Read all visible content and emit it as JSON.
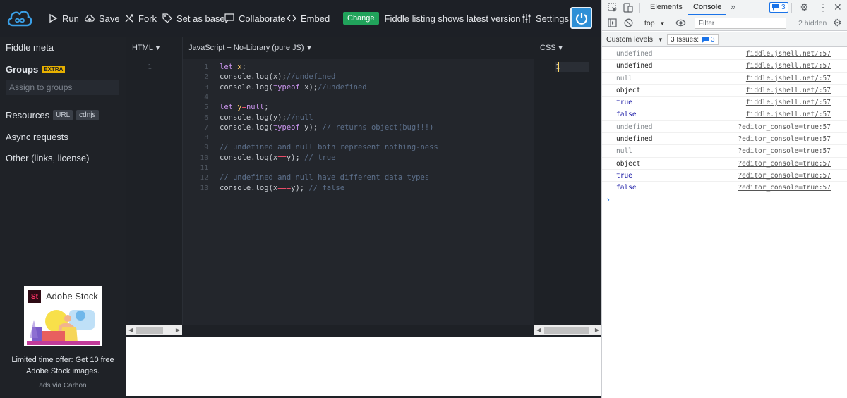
{
  "toolbar": {
    "run": "Run",
    "save": "Save",
    "fork": "Fork",
    "set_as_base": "Set as base",
    "collaborate": "Collaborate",
    "embed": "Embed",
    "change_badge": "Change",
    "listing_text": "Fiddle listing shows latest version",
    "settings": "Settings"
  },
  "sidebar": {
    "fiddle_meta": "Fiddle meta",
    "groups": "Groups",
    "groups_tag": "EXTRA",
    "assign_placeholder": "Assign to groups",
    "resources": "Resources",
    "resources_tag_url": "URL",
    "resources_tag_cdnjs": "cdnjs",
    "async_requests": "Async requests",
    "other": "Other (links, license)",
    "ad": {
      "image_title": "Adobe Stock",
      "image_logo": "St",
      "text_line1": "Limited time offer: Get 10 free",
      "text_line2": "Adobe Stock images.",
      "via": "ads via Carbon"
    }
  },
  "panels": {
    "html": {
      "label": "HTML",
      "line_numbers": [
        "1"
      ]
    },
    "js": {
      "label": "JavaScript + No-Library (pure JS)",
      "line_numbers": [
        "1",
        "2",
        "3",
        "4",
        "5",
        "6",
        "7",
        "8",
        "9",
        "10",
        "11",
        "12",
        "13"
      ]
    },
    "css": {
      "label": "CSS",
      "line_numbers": [
        "1"
      ]
    }
  },
  "code": [
    [
      {
        "t": "let",
        "c": "kw"
      },
      {
        "t": " "
      },
      {
        "t": "x",
        "c": "var"
      },
      {
        "t": ";"
      }
    ],
    [
      {
        "t": "console.log(x);"
      },
      {
        "t": "//undefined",
        "c": "cm"
      }
    ],
    [
      {
        "t": "console.log("
      },
      {
        "t": "typeof",
        "c": "kw"
      },
      {
        "t": " x);"
      },
      {
        "t": "//undefined",
        "c": "cm"
      }
    ],
    [],
    [
      {
        "t": "let",
        "c": "kw"
      },
      {
        "t": " "
      },
      {
        "t": "y",
        "c": "var"
      },
      {
        "t": "=",
        "c": "op"
      },
      {
        "t": "null",
        "c": "kw"
      },
      {
        "t": ";"
      }
    ],
    [
      {
        "t": "console.log(y);"
      },
      {
        "t": "//null",
        "c": "cm"
      }
    ],
    [
      {
        "t": "console.log("
      },
      {
        "t": "typeof",
        "c": "kw"
      },
      {
        "t": " y); "
      },
      {
        "t": "// returns object(bug!!!)",
        "c": "cm"
      }
    ],
    [],
    [
      {
        "t": "// undefined and null both represent nothing-ness",
        "c": "cm"
      }
    ],
    [
      {
        "t": "console.log(x"
      },
      {
        "t": "==",
        "c": "op"
      },
      {
        "t": "y); "
      },
      {
        "t": "// true",
        "c": "cm"
      }
    ],
    [],
    [
      {
        "t": "// undefined and null have different data types",
        "c": "cm"
      }
    ],
    [
      {
        "t": "console.log(x"
      },
      {
        "t": "===",
        "c": "op"
      },
      {
        "t": "y); "
      },
      {
        "t": "// false",
        "c": "cm"
      }
    ]
  ],
  "devtools": {
    "tabs": {
      "elements": "Elements",
      "console": "Console",
      "more": "»"
    },
    "message_count": "3",
    "context": "top",
    "filter_placeholder": "Filter",
    "hidden": "2 hidden",
    "custom_levels": "Custom levels",
    "issues_label": "3 Issues:",
    "issues_count": "3",
    "prompt": "›",
    "rows": [
      {
        "value": "undefined",
        "source": "fiddle.jshell.net/:57",
        "dim": true
      },
      {
        "value": "undefined",
        "source": "fiddle.jshell.net/:57",
        "dim": false
      },
      {
        "value": "null",
        "source": "fiddle.jshell.net/:57",
        "dim": true
      },
      {
        "value": "object",
        "source": "fiddle.jshell.net/:57",
        "dim": false
      },
      {
        "value": "true",
        "source": "fiddle.jshell.net/:57",
        "dim": false,
        "blue": true
      },
      {
        "value": "false",
        "source": "fiddle.jshell.net/:57",
        "dim": false,
        "blue": true
      },
      {
        "value": "undefined",
        "source": "?editor_console=true:57",
        "dim": true
      },
      {
        "value": "undefined",
        "source": "?editor_console=true:57",
        "dim": false
      },
      {
        "value": "null",
        "source": "?editor_console=true:57",
        "dim": true
      },
      {
        "value": "object",
        "source": "?editor_console=true:57",
        "dim": false
      },
      {
        "value": "true",
        "source": "?editor_console=true:57",
        "dim": false,
        "blue": true
      },
      {
        "value": "false",
        "source": "?editor_console=true:57",
        "dim": false,
        "blue": true
      }
    ]
  }
}
